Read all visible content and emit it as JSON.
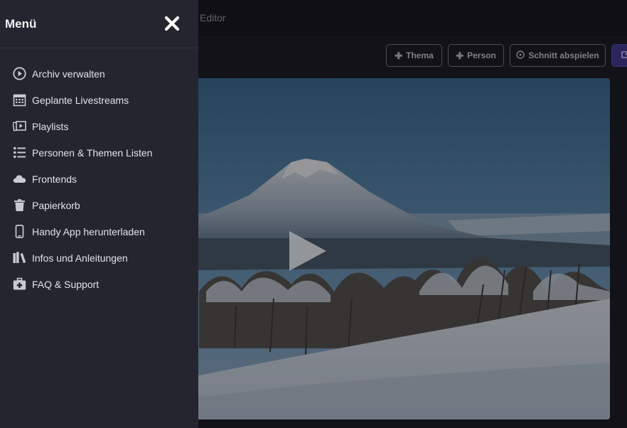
{
  "topbar": {
    "title": "Editor"
  },
  "toolbar": {
    "theme_label": "Thema",
    "person_label": "Person",
    "play_cut_label": "Schnitt abspielen"
  },
  "menu": {
    "title": "Menü",
    "items": [
      {
        "label": "Archiv verwalten",
        "icon": "play-circle-icon"
      },
      {
        "label": "Geplante Livestreams",
        "icon": "calendar-icon"
      },
      {
        "label": "Playlists",
        "icon": "playlist-icon"
      },
      {
        "label": "Personen & Themen Listen",
        "icon": "list-icon"
      },
      {
        "label": "Frontends",
        "icon": "cloud-icon"
      },
      {
        "label": "Papierkorb",
        "icon": "trash-icon"
      },
      {
        "label": "Handy App herunterladen",
        "icon": "mobile-icon"
      },
      {
        "label": "Infos und Anleitungen",
        "icon": "books-icon"
      },
      {
        "label": "FAQ & Support",
        "icon": "first-aid-icon"
      }
    ]
  },
  "colors": {
    "menu_bg": "#252530",
    "app_bg": "#18181e",
    "primary_button": "#3a3480"
  }
}
